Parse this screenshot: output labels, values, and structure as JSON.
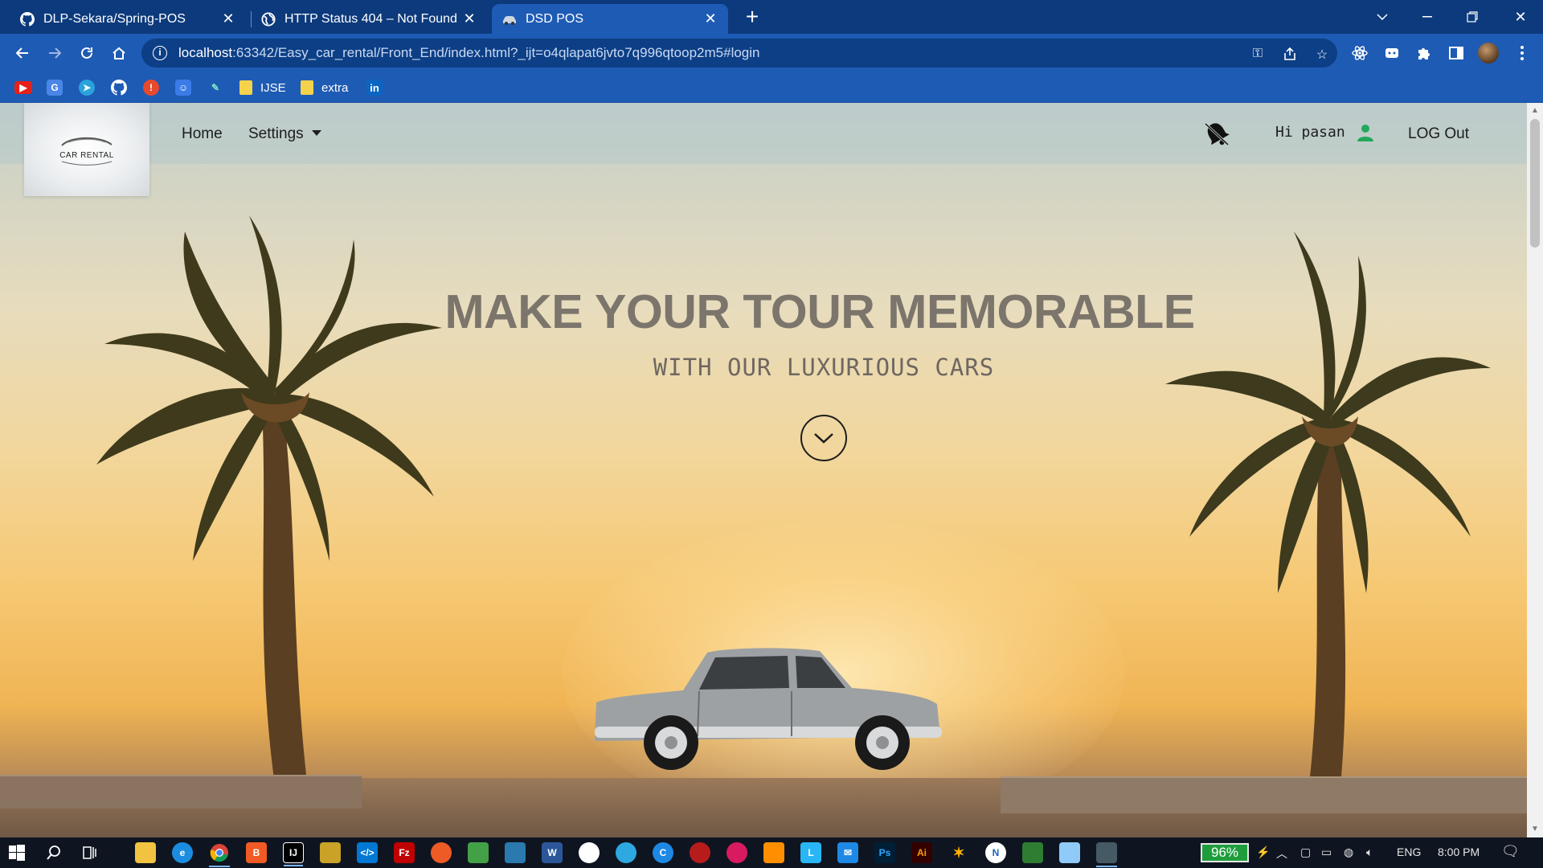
{
  "browser": {
    "tabs": [
      {
        "title": "DLP-Sekara/Spring-POS",
        "icon": "github-icon",
        "active": false
      },
      {
        "title": "HTTP Status 404 – Not Found",
        "icon": "globe-icon",
        "active": false
      },
      {
        "title": "DSD POS",
        "icon": "car-icon",
        "active": true
      }
    ],
    "url_host": "localhost",
    "url_rest": ":63342/Easy_car_rental/Front_End/index.html?_ijt=o4qlapat6jvto7q996qtoop2m5#login",
    "bookmarks": [
      {
        "label": "IJSE",
        "type": "folder"
      },
      {
        "label": "extra",
        "type": "folder"
      }
    ],
    "bookmark_icons": [
      "youtube-icon",
      "google-translate-icon",
      "telegram-icon",
      "github-icon",
      "alert-icon",
      "contacts-icon",
      "pencil-icon",
      "linkedin-icon"
    ]
  },
  "site": {
    "logo_text": "CAR RENTAL",
    "nav": {
      "home": "Home",
      "settings": "Settings"
    },
    "greeting": "Hi pasan",
    "logout": "LOG Out",
    "hero": {
      "title": "MAKE YOUR TOUR MEMORABLE",
      "subtitle": "WITH OUR LUXURIOUS CARS"
    }
  },
  "taskbar": {
    "battery": "96%",
    "language": "ENG",
    "time": "8:00 PM"
  },
  "colors": {
    "chrome_dark": "#0c3a7c",
    "chrome": "#1e5bb4",
    "hero_title": "#7b756c",
    "user_icon": "#22a85a",
    "battery": "#1f9d3d"
  }
}
